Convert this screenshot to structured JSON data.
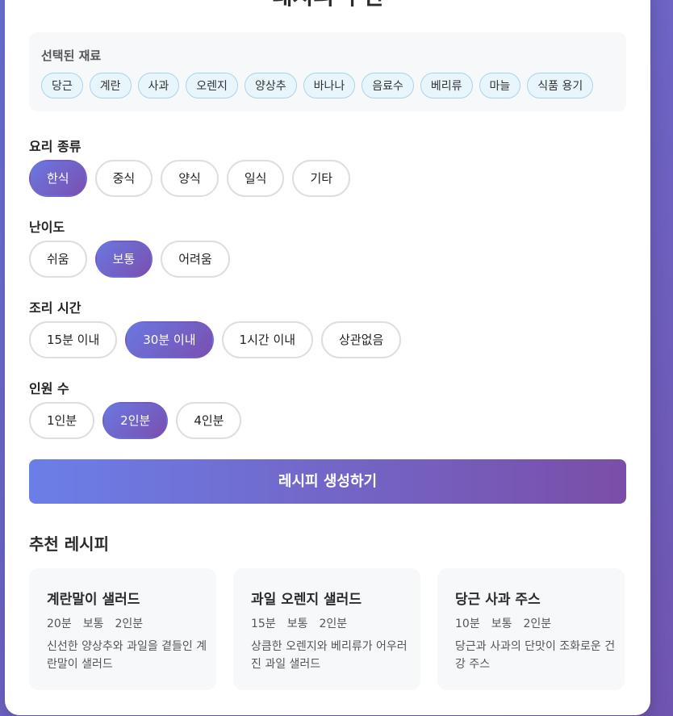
{
  "page": {
    "title": "레시피 추천"
  },
  "ingredients": {
    "label": "선택된 재료",
    "tags": [
      "당근",
      "계란",
      "사과",
      "오렌지",
      "양상추",
      "바나나",
      "음료수",
      "베리류",
      "마늘",
      "식품 용기"
    ]
  },
  "cuisine": {
    "label": "요리 종류",
    "options": [
      "한식",
      "중식",
      "양식",
      "일식",
      "기타"
    ],
    "selected": "한식"
  },
  "difficulty": {
    "label": "난이도",
    "options": [
      "쉬움",
      "보통",
      "어려움"
    ],
    "selected": "보통"
  },
  "time": {
    "label": "조리 시간",
    "options": [
      "15분 이내",
      "30분 이내",
      "1시간 이내",
      "상관없음"
    ],
    "selected": "30분 이내"
  },
  "servings": {
    "label": "인원 수",
    "options": [
      "1인분",
      "2인분",
      "4인분"
    ],
    "selected": "2인분"
  },
  "generate_button": "레시피 생성하기",
  "recommendations": {
    "title": "추천 레시피",
    "items": [
      {
        "name": "계란말이 샐러드",
        "time": "20분",
        "difficulty": "보통",
        "servings": "2인분",
        "desc": "신선한 양상추와 과일을 곁들인 계란말이 샐러드"
      },
      {
        "name": "과일 오렌지 샐러드",
        "time": "15분",
        "difficulty": "보통",
        "servings": "2인분",
        "desc": "상큼한 오렌지와 베리류가 어우러진 과일 샐러드"
      },
      {
        "name": "당근 사과 주스",
        "time": "10분",
        "difficulty": "보통",
        "servings": "2인분",
        "desc": "당근과 사과의 단맛이 조화로운 건강 주스"
      }
    ]
  }
}
